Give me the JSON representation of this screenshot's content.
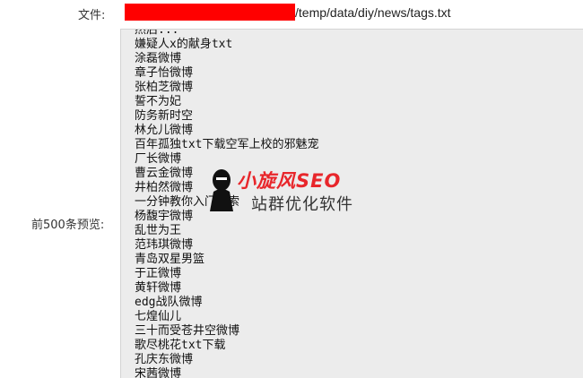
{
  "form": {
    "file_label": "文件:",
    "file_path_visible": "/temp/data/diy/news/tags.txt",
    "preview_label": "前500条预览:"
  },
  "preview": {
    "lines": [
      "然后...",
      "嫌疑人x的献身txt",
      "涂磊微博",
      "章子怡微博",
      "张柏芝微博",
      "誓不为妃",
      "防务新时空",
      "林允儿微博",
      "百年孤独txt下载空军上校的邪魅宠",
      "厂长微博",
      "曹云金微博",
      "井柏然微博",
      "一分钟教你入门搜索",
      "杨馥宇微博",
      "乱世为王",
      "范玮琪微博",
      "青岛双星男篮",
      "于正微博",
      "黄轩微博",
      "edg战队微博",
      "七煌仙儿",
      "三十而受苍井空微博",
      "歌尽桃花txt下载",
      "孔庆东微博",
      "宋茜微博"
    ]
  },
  "watermark": {
    "brand": "小旋风SEO",
    "subtitle": "站群优化软件",
    "brand_color": "#e8262b"
  },
  "colors": {
    "redaction": "#ff0000",
    "textarea_bg": "#ececec"
  }
}
